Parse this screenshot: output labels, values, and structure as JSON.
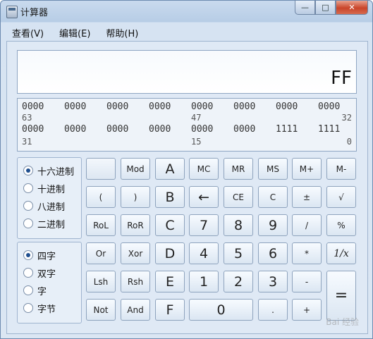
{
  "window": {
    "title": "计算器",
    "min_label": "—",
    "max_label": "□",
    "close_label": "✕"
  },
  "menu": [
    "查看(V)",
    "编辑(E)",
    "帮助(H)"
  ],
  "display": {
    "value": "FF"
  },
  "bits": {
    "row1": [
      "0000",
      "0000",
      "0000",
      "0000",
      "0000",
      "0000",
      "0000",
      "0000"
    ],
    "row1_pos": [
      "63",
      "47",
      "32"
    ],
    "row2": [
      "0000",
      "0000",
      "0000",
      "0000",
      "0000",
      "0000",
      "1111",
      "1111"
    ],
    "row2_pos": [
      "31",
      "15",
      "0"
    ]
  },
  "base_options": [
    {
      "label": "十六进制",
      "selected": true
    },
    {
      "label": "十进制",
      "selected": false
    },
    {
      "label": "八进制",
      "selected": false
    },
    {
      "label": "二进制",
      "selected": false
    }
  ],
  "word_options": [
    {
      "label": "四字",
      "selected": true
    },
    {
      "label": "双字",
      "selected": false
    },
    {
      "label": "字",
      "selected": false
    },
    {
      "label": "字节",
      "selected": false
    }
  ],
  "keys": {
    "r1": [
      "",
      "Mod",
      "A",
      "MC",
      "MR",
      "MS",
      "M+",
      "M-"
    ],
    "r2": [
      "(",
      ")",
      "B",
      "←",
      "CE",
      "C",
      "±",
      "√"
    ],
    "r3": [
      "RoL",
      "RoR",
      "C",
      "7",
      "8",
      "9",
      "/",
      "%"
    ],
    "r4": [
      "Or",
      "Xor",
      "D",
      "4",
      "5",
      "6",
      "*",
      "1/x"
    ],
    "r5": [
      "Lsh",
      "Rsh",
      "E",
      "1",
      "2",
      "3",
      "-",
      "="
    ],
    "r6": [
      "Not",
      "And",
      "F",
      "0",
      ".",
      "+"
    ]
  },
  "watermark": "Bai 经验"
}
